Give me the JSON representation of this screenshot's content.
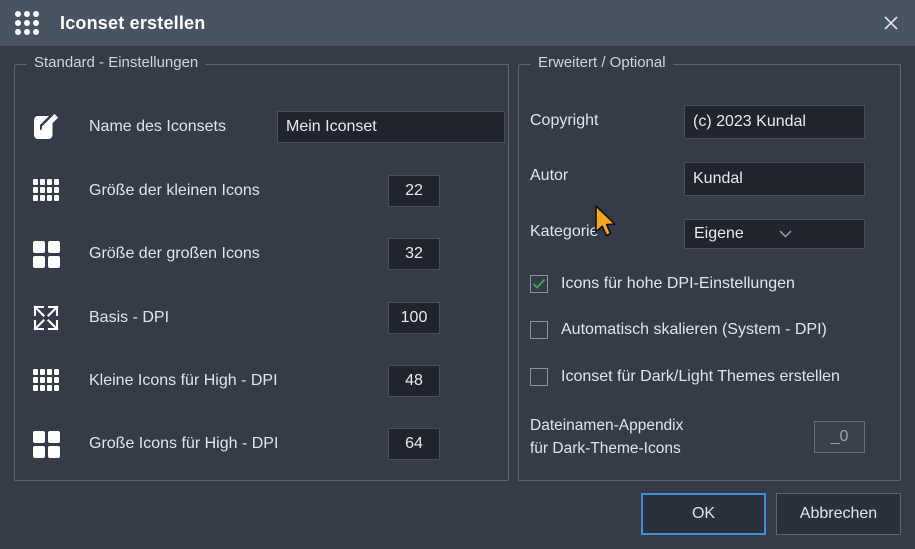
{
  "window": {
    "title": "Iconset erstellen",
    "app_icon": "grid-dots-icon",
    "close_icon": "close-icon"
  },
  "standard_group": {
    "title": "Standard - Einstellungen",
    "rows": [
      {
        "icon": "pencil-edit-icon",
        "label": "Name des Iconsets",
        "value": "Mein Iconset",
        "type": "text"
      },
      {
        "icon": "grid-small-icon",
        "label": "Größe der kleinen Icons",
        "value": "22",
        "type": "number"
      },
      {
        "icon": "grid-large-icon",
        "label": "Größe der großen Icons",
        "value": "32",
        "type": "number"
      },
      {
        "icon": "expand-arrows-icon",
        "label": "Basis - DPI",
        "value": "100",
        "type": "number"
      },
      {
        "icon": "grid-small-icon",
        "label": "Kleine Icons für High - DPI",
        "value": "48",
        "type": "number"
      },
      {
        "icon": "grid-large-icon",
        "label": "Große Icons für High - DPI",
        "value": "64",
        "type": "number"
      }
    ]
  },
  "advanced_group": {
    "title": "Erweitert / Optional",
    "copyright_label": "Copyright",
    "copyright_value": "(c) 2023 Kundal",
    "author_label": "Autor",
    "author_value": "Kundal",
    "category_label": "Kategorie",
    "category_value": "Eigene",
    "category_options": [
      "Eigene"
    ],
    "checkboxes": [
      {
        "label": "Icons für hohe DPI-Einstellungen",
        "checked": true
      },
      {
        "label": "Automatisch skalieren (System - DPI)",
        "checked": false
      },
      {
        "label": "Iconset für Dark/Light Themes erstellen",
        "checked": false
      }
    ],
    "appendix_label_line1": "Dateinamen-Appendix",
    "appendix_label_line2": "für Dark-Theme-Icons",
    "appendix_value": "_0",
    "appendix_enabled": false
  },
  "footer": {
    "ok_label": "OK",
    "cancel_label": "Abbrechen"
  },
  "colors": {
    "titlebar": "#4a5364",
    "body": "#353c48",
    "field": "#20242c",
    "border": "#5a6575",
    "text": "#dfe5ed",
    "accent": "#3f8fd6",
    "check": "#3faa55",
    "cursor": "#f5a623"
  }
}
